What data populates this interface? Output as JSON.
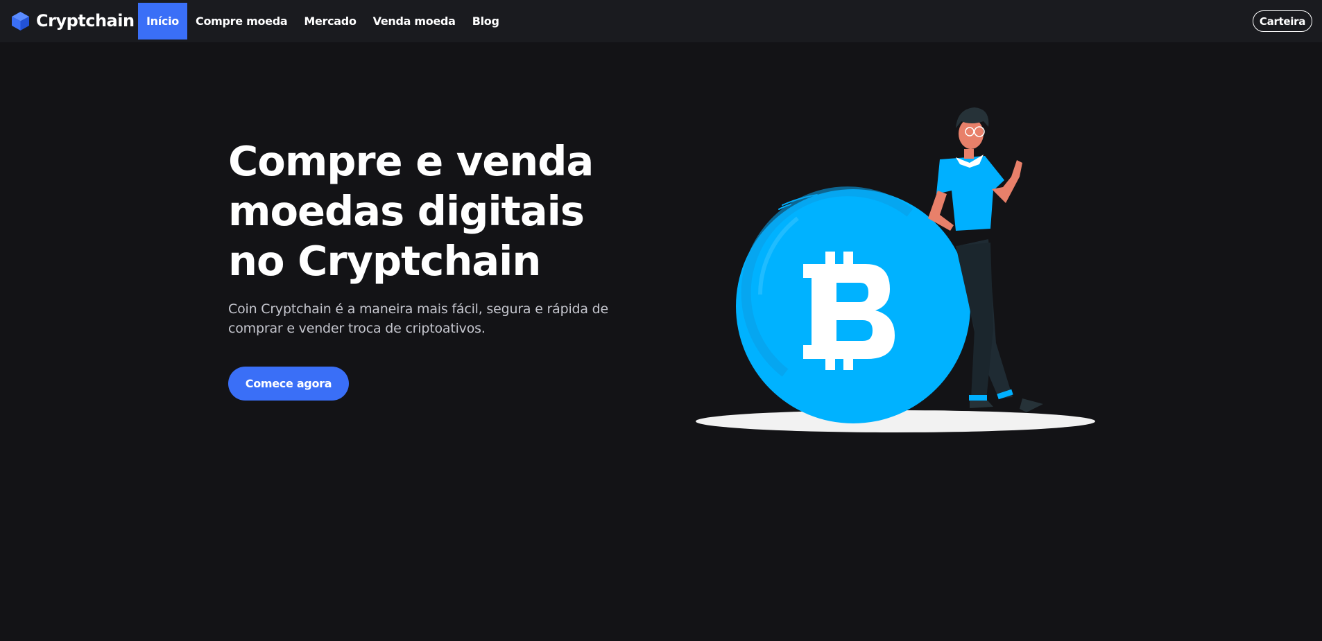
{
  "brand": {
    "name": "Cryptchain",
    "logo_icon": "cube-icon",
    "logo_color": "#3a6ff7"
  },
  "nav": {
    "items": [
      {
        "label": "Início",
        "active": true
      },
      {
        "label": "Compre moeda",
        "active": false
      },
      {
        "label": "Mercado",
        "active": false
      },
      {
        "label": "Venda moeda",
        "active": false
      },
      {
        "label": "Blog",
        "active": false
      }
    ],
    "wallet_label": "Carteira"
  },
  "hero": {
    "title_lines": [
      "Compre e venda",
      "moedas digitais",
      "no Cryptchain"
    ],
    "subtitle_lines": [
      "Coin Cryptchain é a maneira mais fácil, segura e rápida de",
      "comprar e vender troca de criptoativos."
    ],
    "cta_label": "Comece agora",
    "illustration": "person-leaning-on-bitcoin-coin-illustration"
  },
  "colors": {
    "background": "#131316",
    "navbar": "#1a1b1f",
    "accent": "#3a6ff7",
    "coin": "#00b0ff",
    "text": "#ffffff",
    "text_muted": "#c5c6ce"
  }
}
